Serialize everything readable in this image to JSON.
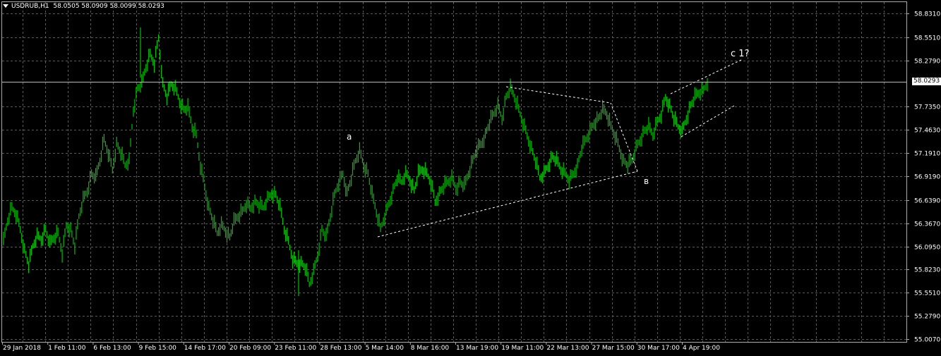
{
  "header": {
    "symbol": "USDRUB,H1",
    "ohlc": "58.0505 58.0909 58.0099 58.0293"
  },
  "current_price_label": "58.0293",
  "colors": {
    "background": "#000000",
    "candle": "#00c000",
    "grid": "#5a5a5a",
    "annotation": "#ffffff",
    "text": "#ffffff"
  },
  "chart_data": {
    "type": "line",
    "title": "USDRUB,H1",
    "y_ticks": [
      "58.8310",
      "58.5510",
      "58.2790",
      "57.7350",
      "57.4630",
      "57.1910",
      "56.9190",
      "56.6390",
      "56.3670",
      "56.0950",
      "55.8230",
      "55.5510",
      "55.2790",
      "55.0070"
    ],
    "ylim": [
      55.007,
      58.831
    ],
    "x_ticks": [
      "29 Jan 2018",
      "1 Feb 11:00",
      "6 Feb 13:00",
      "9 Feb 15:00",
      "14 Feb 17:00",
      "20 Feb 09:00",
      "23 Feb 11:00",
      "28 Feb 13:00",
      "5 Mar 14:00",
      "8 Mar 16:00",
      "13 Mar 19:00",
      "19 Mar 11:00",
      "22 Mar 13:00",
      "27 Mar 15:00",
      "30 Mar 17:00",
      "4 Apr 19:00"
    ],
    "grid": true,
    "current_price": 58.0293,
    "series": [
      {
        "values": [
          56.15,
          56.4,
          56.55,
          56.48,
          56.3,
          56.05,
          55.88,
          56.1,
          56.22,
          56.18,
          56.3,
          56.12,
          56.2,
          56.25,
          56.02,
          56.35,
          56.3,
          56.1,
          56.45,
          56.65,
          56.75,
          56.95,
          56.9,
          57.1,
          57.35,
          57.2,
          57.0,
          57.3,
          57.2,
          57.05,
          57.1,
          57.7,
          57.95,
          58.0,
          58.2,
          58.35,
          58.25,
          58.55,
          58.0,
          57.85,
          58.0,
          57.95,
          57.8,
          57.7,
          57.72,
          57.5,
          57.4,
          57.05,
          56.8,
          56.55,
          56.4,
          56.25,
          56.35,
          56.28,
          56.2,
          56.38,
          56.45,
          56.5,
          56.6,
          56.55,
          56.62,
          56.58,
          56.55,
          56.65,
          56.72,
          56.7,
          56.55,
          56.3,
          56.15,
          55.95,
          55.9,
          55.9,
          55.85,
          55.65,
          55.8,
          56.0,
          56.3,
          56.2,
          56.45,
          56.7,
          56.85,
          56.95,
          56.72,
          56.9,
          57.1,
          57.22,
          57.05,
          56.95,
          56.7,
          56.5,
          56.3,
          56.45,
          56.6,
          56.75,
          56.9,
          56.85,
          56.95,
          56.88,
          56.75,
          56.95,
          57.0,
          56.95,
          56.85,
          56.62,
          56.72,
          56.8,
          56.85,
          56.9,
          56.78,
          56.85,
          56.8,
          56.95,
          57.1,
          57.25,
          57.3,
          57.4,
          57.55,
          57.65,
          57.75,
          57.6,
          57.85,
          57.95,
          57.85,
          57.7,
          57.55,
          57.4,
          57.25,
          57.1,
          56.9,
          56.95,
          57.05,
          57.15,
          57.1,
          57.0,
          56.95,
          56.88,
          56.95,
          57.05,
          57.25,
          57.35,
          57.45,
          57.55,
          57.6,
          57.7,
          57.65,
          57.5,
          57.4,
          57.25,
          57.1,
          57.05,
          57.1,
          57.25,
          57.35,
          57.45,
          57.5,
          57.4,
          57.55,
          57.65,
          57.85,
          57.75,
          57.6,
          57.5,
          57.45,
          57.6,
          57.75,
          57.85,
          57.9,
          57.92,
          58.03
        ]
      }
    ],
    "annotations": [
      {
        "label": "a"
      },
      {
        "label": "в"
      },
      {
        "label": "c 1?"
      }
    ]
  }
}
